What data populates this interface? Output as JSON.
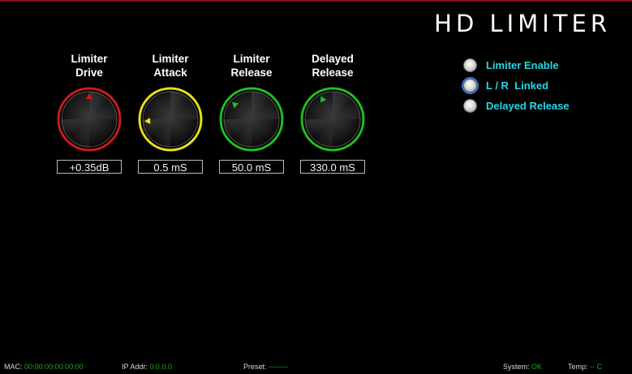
{
  "title": "HD LIMITER",
  "knobs": [
    {
      "label": "Limiter\nDrive",
      "value": "+0.35dB",
      "ring_color": "#d01818",
      "pointer_color": "#e01010",
      "level": 0.5
    },
    {
      "label": "Limiter\nAttack",
      "value": "0.5 mS",
      "ring_color": "#e6e01a",
      "pointer_color": "#f0e020",
      "level": 0.15
    },
    {
      "label": "Limiter\nRelease",
      "value": "50.0 mS",
      "ring_color": "#1fbf1f",
      "pointer_color": "#20c020",
      "level": 0.32
    },
    {
      "label": "Delayed\nRelease",
      "value": "330.0 mS",
      "ring_color": "#1fbf1f",
      "pointer_color": "#20c020",
      "level": 0.4
    }
  ],
  "options": [
    {
      "label": "Limiter Enable",
      "focused": false
    },
    {
      "label": "L / R  Linked",
      "focused": true
    },
    {
      "label": "Delayed Release",
      "focused": false
    }
  ],
  "footer": {
    "mac_label": "MAC:",
    "mac_value": "00:00:00:00:00:00",
    "ip_label": "IP Addr:",
    "ip_value": "0.0.0.0",
    "preset_label": "Preset:",
    "preset_value": "--------",
    "system_label": "System:",
    "system_value": "OK",
    "temp_label": "Temp:",
    "temp_value": "-- C"
  },
  "colors": {
    "accent": "#28d6e6",
    "footer_value": "#1fa51f"
  }
}
